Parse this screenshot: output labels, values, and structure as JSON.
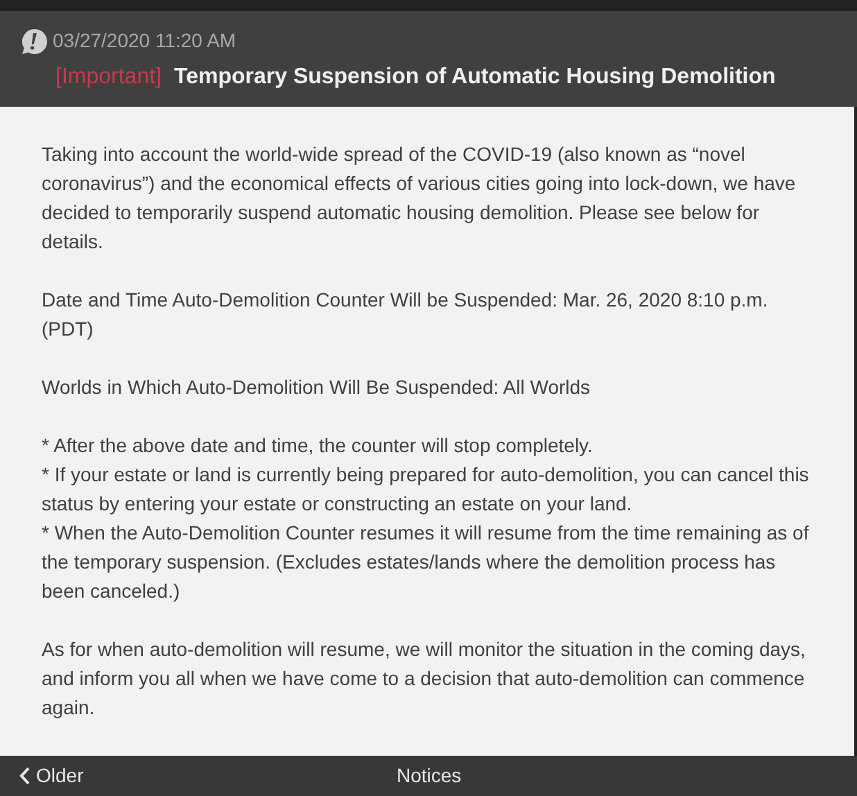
{
  "header": {
    "date": "03/27/2020 11:20 AM",
    "tag": "[Important]",
    "title": "Temporary Suspension of Automatic Housing Demolition"
  },
  "paragraphs": [
    "Taking into account the world-wide spread of the COVID-19 (also known as “novel coronavirus”) and the economical effects of various cities going into lock-down, we have decided to temporarily suspend automatic housing demolition. Please see below for details.",
    "Date and Time Auto-Demolition Counter Will be Suspended: Mar. 26, 2020 8:10 p.m. (PDT)",
    "Worlds in Which Auto-Demolition Will Be Suspended: All Worlds",
    [
      "* After the above date and time, the counter will stop completely.",
      "* If your estate or land is currently being prepared for auto-demolition, you can cancel this status by entering your estate or constructing an estate on your land.",
      "* When the Auto-Demolition Counter resumes it will resume from the time remaining as of the temporary suspension. (Excludes estates/lands where the demolition process has been canceled.)"
    ],
    "As for when auto-demolition will resume, we will monitor the situation in the coming days, and inform you all when we have come to a decision that auto-demolition can commence again."
  ],
  "footer": {
    "back": "Older",
    "title": "Notices"
  }
}
